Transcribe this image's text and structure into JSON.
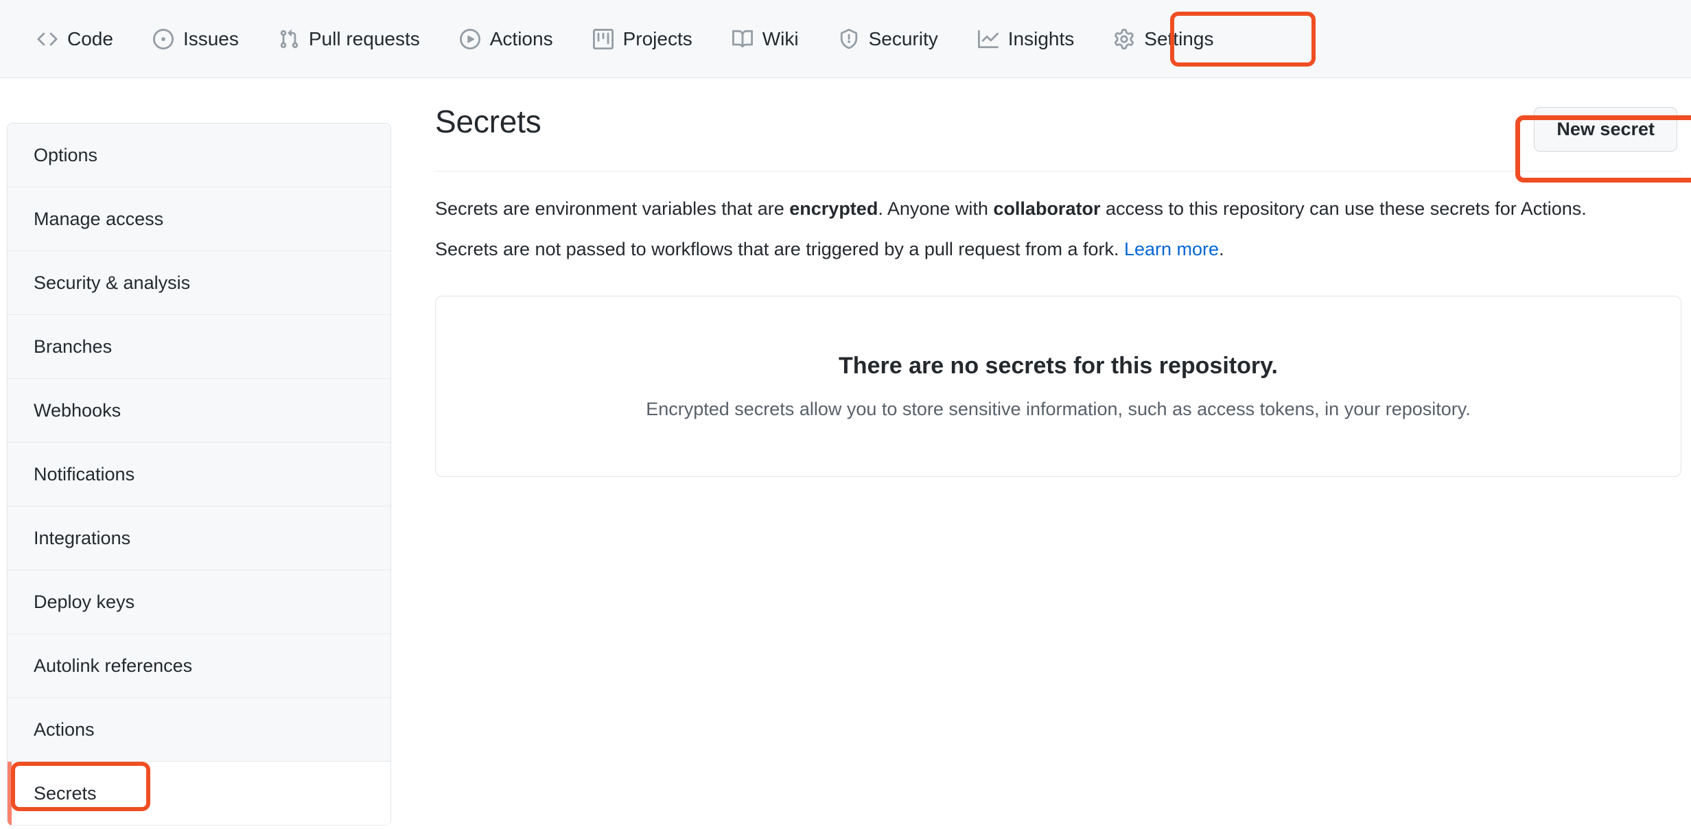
{
  "repo_nav": {
    "items": [
      {
        "label": "Code",
        "icon": "code-icon"
      },
      {
        "label": "Issues",
        "icon": "issue-opened-icon"
      },
      {
        "label": "Pull requests",
        "icon": "git-pull-request-icon"
      },
      {
        "label": "Actions",
        "icon": "play-icon"
      },
      {
        "label": "Projects",
        "icon": "project-icon"
      },
      {
        "label": "Wiki",
        "icon": "book-icon"
      },
      {
        "label": "Security",
        "icon": "shield-icon"
      },
      {
        "label": "Insights",
        "icon": "graph-icon"
      },
      {
        "label": "Settings",
        "icon": "gear-icon"
      }
    ],
    "selected": "Settings"
  },
  "sidebar": {
    "items": [
      {
        "label": "Options"
      },
      {
        "label": "Manage access"
      },
      {
        "label": "Security & analysis"
      },
      {
        "label": "Branches"
      },
      {
        "label": "Webhooks"
      },
      {
        "label": "Notifications"
      },
      {
        "label": "Integrations"
      },
      {
        "label": "Deploy keys"
      },
      {
        "label": "Autolink references"
      },
      {
        "label": "Actions"
      },
      {
        "label": "Secrets"
      }
    ],
    "active": "Secrets"
  },
  "main": {
    "title": "Secrets",
    "new_secret_label": "New secret",
    "description_1": {
      "part_a": "Secrets are environment variables that are ",
      "bold_a": "encrypted",
      "part_b": ". Anyone with ",
      "bold_b": "collaborator",
      "part_c": " access to this repository can use these secrets for Actions."
    },
    "description_2": {
      "part_a": "Secrets are not passed to workflows that are triggered by a pull request from a fork. ",
      "link": "Learn more",
      "part_b": "."
    },
    "empty_state": {
      "title": "There are no secrets for this repository.",
      "subtitle": "Encrypted secrets allow you to store sensitive information, such as access tokens, in your repository."
    }
  },
  "colors": {
    "highlight": "#ef4e23",
    "active_indicator": "#f9826c",
    "link": "#0366d6",
    "nav_background": "#f6f8fa",
    "text": "#24292e",
    "muted_text": "#586069",
    "border": "#e1e4e8"
  }
}
